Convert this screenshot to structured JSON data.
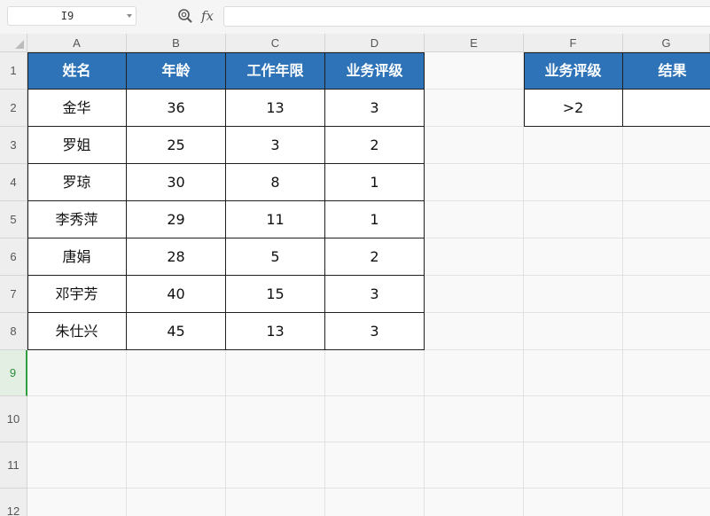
{
  "formula_bar": {
    "name_box": "I9",
    "fx_label": "fx",
    "formula": ""
  },
  "columns": [
    "A",
    "B",
    "C",
    "D",
    "E",
    "F",
    "G"
  ],
  "rows": [
    "1",
    "2",
    "3",
    "4",
    "5",
    "6",
    "7",
    "8",
    "9",
    "10",
    "11",
    "12"
  ],
  "active_row": "9",
  "main_table": {
    "headers": [
      "姓名",
      "年龄",
      "工作年限",
      "业务评级"
    ],
    "rows": [
      [
        "金华",
        "36",
        "13",
        "3"
      ],
      [
        "罗姐",
        "25",
        "3",
        "2"
      ],
      [
        "罗琼",
        "30",
        "8",
        "1"
      ],
      [
        "李秀萍",
        "29",
        "11",
        "1"
      ],
      [
        "唐娟",
        "28",
        "5",
        "2"
      ],
      [
        "邓宇芳",
        "40",
        "15",
        "3"
      ],
      [
        "朱仕兴",
        "45",
        "13",
        "3"
      ]
    ]
  },
  "criteria_table": {
    "headers": [
      "业务评级",
      "结果"
    ],
    "rows": [
      [
        ">2",
        ""
      ]
    ]
  },
  "colors": {
    "header_fill": "#2e73b8",
    "header_text": "#ffffff",
    "active_row_accent": "#2e9e3e"
  }
}
